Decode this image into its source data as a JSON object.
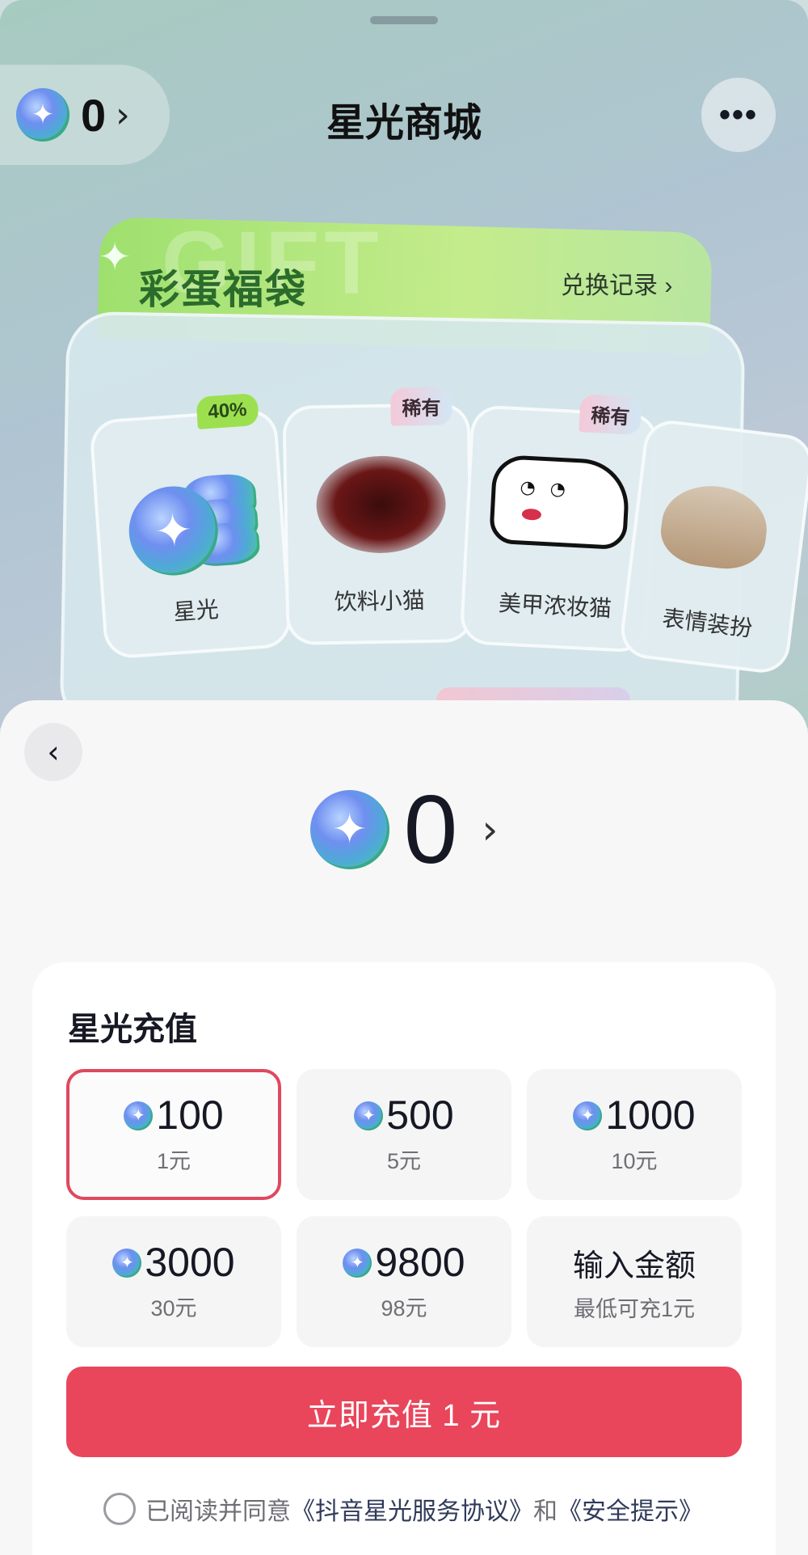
{
  "store": {
    "balance": "0",
    "title": "星光商城",
    "gift_bg_text": "GIFT",
    "gift_title": "彩蛋福袋",
    "history_link": "兑换记录 ›",
    "cards": [
      {
        "label": "星光",
        "badge": "40%"
      },
      {
        "label": "饮料小猫",
        "badge": "稀有"
      },
      {
        "label": "美甲浓妆猫",
        "badge": "稀有"
      },
      {
        "label": "表情装扮"
      }
    ]
  },
  "sheet": {
    "balance": "0",
    "section_title": "星光充值",
    "options": [
      {
        "amount": "100",
        "price": "1元",
        "selected": true
      },
      {
        "amount": "500",
        "price": "5元"
      },
      {
        "amount": "1000",
        "price": "10元"
      },
      {
        "amount": "3000",
        "price": "30元"
      },
      {
        "amount": "9800",
        "price": "98元"
      }
    ],
    "custom": {
      "title": "输入金额",
      "subtitle": "最低可充1元"
    },
    "pay_button": "立即充值 1 元",
    "agreement": {
      "prefix": "已阅读并同意",
      "link1": "《抖音星光服务协议》",
      "middle": "和",
      "link2": "《安全提示》"
    }
  },
  "colors": {
    "accent": "#e9465c",
    "selected_border": "#e0485e",
    "badge_green": "#9de04f"
  }
}
